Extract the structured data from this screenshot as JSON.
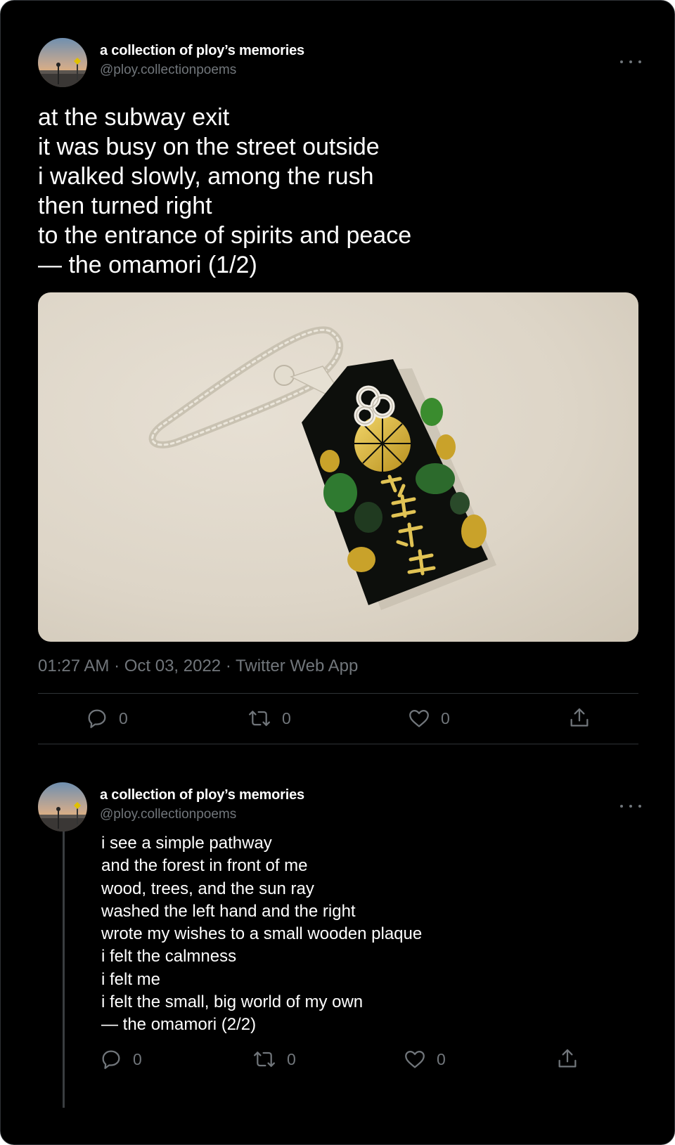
{
  "tweet": {
    "author_name": "a collection of ploy’s memories",
    "author_handle": "@ploy.collectionpoems",
    "lines": [
      "at the subway exit",
      "it was busy on the street outside",
      "i walked slowly, among the rush",
      "then turned right",
      "to the entrance of spirits and peace",
      "— the omamori (1/2)"
    ],
    "timestamp": "01:27 AM · Oct 03, 2022 · Twitter Web App",
    "actions": {
      "replies": "0",
      "retweets": "0",
      "likes": "0"
    },
    "photo_alt": "omamori charm photo"
  },
  "reply": {
    "author_name": "a collection of ploy’s memories",
    "author_handle": "@ploy.collectionpoems",
    "lines": [
      "i see a simple pathway",
      "and the forest in front of me",
      "wood, trees, and the sun ray",
      "washed the left hand and the right",
      "wrote my wishes to a small wooden plaque",
      "i felt the calmness",
      "i felt me",
      "i felt the small, big world of my own",
      "— the omamori (2/2)"
    ],
    "actions": {
      "replies": "0",
      "retweets": "0",
      "likes": "0"
    }
  },
  "icons": {
    "reply": "speech-bubble-icon",
    "retweet": "retweet-arrows-icon",
    "like": "heart-icon",
    "share": "share-upload-icon",
    "more": "more-dots-icon"
  },
  "colors": {
    "background": "#000000",
    "text_primary": "#ffffff",
    "text_secondary": "#71767b",
    "divider": "#2f3336"
  }
}
